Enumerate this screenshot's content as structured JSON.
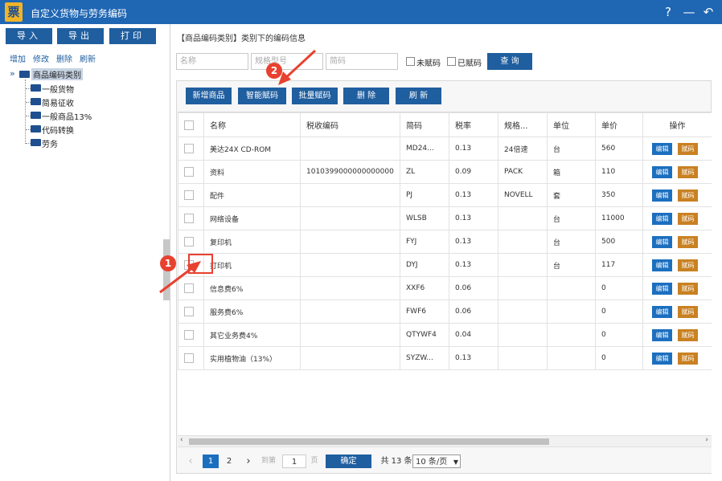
{
  "titlebar": {
    "logo_char": "票",
    "title": "自定义货物与劳务编码",
    "help": "?",
    "minimize": "—",
    "back": "↶"
  },
  "left": {
    "import_label": "导入",
    "export_label": "导出",
    "print_label": "打印",
    "links": [
      "增加",
      "修改",
      "删除",
      "刷新"
    ],
    "tree": {
      "toggle": "»",
      "root": "商品编码类别",
      "children": [
        "一般货物",
        "简易征收",
        "一般商品13%",
        "代码转换",
        "劳务"
      ]
    }
  },
  "right": {
    "section_title": "【商品编码类别】类别下的编码信息",
    "search": {
      "name_placeholder": "名称",
      "spec_placeholder": "规格型号",
      "abbr_placeholder": "简码",
      "unassigned_label": "未赋码",
      "assigned_label": "已赋码",
      "query_label": "查 询"
    },
    "toolbar": {
      "add_label": "新增商品",
      "smart_label": "智能赋码",
      "batch_label": "批量赋码",
      "delete_label": "删 除",
      "refresh_label": "刷 新"
    },
    "table": {
      "headers": [
        "名称",
        "税收编码",
        "简码",
        "税率",
        "规格...",
        "单位",
        "单价",
        "操作"
      ],
      "edit_label": "编辑",
      "assign_label": "赋码",
      "rows": [
        {
          "name": "美达24X CD-ROM",
          "tax": "",
          "abbr": "MD24...",
          "rate": "0.13",
          "spec": "24倍速",
          "unit": "台",
          "price": "560"
        },
        {
          "name": "资料",
          "tax": "1010399000000000000",
          "abbr": "ZL",
          "rate": "0.09",
          "spec": "PACK",
          "unit": "箱",
          "price": "110"
        },
        {
          "name": "配件",
          "tax": "",
          "abbr": "PJ",
          "rate": "0.13",
          "spec": "NOVELL",
          "unit": "套",
          "price": "350"
        },
        {
          "name": "网络设备",
          "tax": "",
          "abbr": "WLSB",
          "rate": "0.13",
          "spec": "",
          "unit": "台",
          "price": "11000"
        },
        {
          "name": "复印机",
          "tax": "",
          "abbr": "FYJ",
          "rate": "0.13",
          "spec": "",
          "unit": "台",
          "price": "500"
        },
        {
          "name": "打印机",
          "tax": "",
          "abbr": "DYJ",
          "rate": "0.13",
          "spec": "",
          "unit": "台",
          "price": "117"
        },
        {
          "name": "信息费6%",
          "tax": "",
          "abbr": "XXF6",
          "rate": "0.06",
          "spec": "",
          "unit": "",
          "price": "0"
        },
        {
          "name": "服务费6%",
          "tax": "",
          "abbr": "FWF6",
          "rate": "0.06",
          "spec": "",
          "unit": "",
          "price": "0"
        },
        {
          "name": "其它业务费4%",
          "tax": "",
          "abbr": "QTYWF4",
          "rate": "0.04",
          "spec": "",
          "unit": "",
          "price": "0"
        },
        {
          "name": "实用植物油（13%）",
          "tax": "",
          "abbr": "SYZW...",
          "rate": "0.13",
          "spec": "",
          "unit": "",
          "price": "0"
        }
      ]
    },
    "pager": {
      "prev": "‹",
      "page1": "1",
      "page2": "2",
      "next": "›",
      "goto_label": "到第",
      "goto_value": "1",
      "page_suffix": "页",
      "confirm_label": "确定",
      "total_label": "共 13 条",
      "page_size": "10 条/页"
    }
  },
  "annotations": {
    "step1": "1",
    "step2": "2"
  },
  "colors": {
    "titlebar": "#1f66b3",
    "primary_button": "#1f5e9f",
    "edit_button": "#1c6fbf",
    "assign_button": "#c98122",
    "annotation": "#e8412f"
  }
}
